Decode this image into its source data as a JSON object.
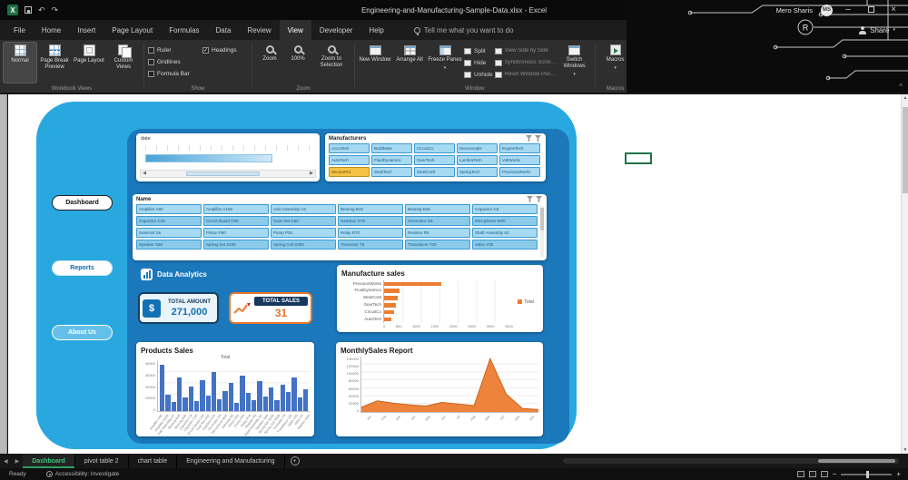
{
  "title_bar": {
    "title": "Engineering-and-Manufacturing-Sample-Data.xlsx - Excel",
    "user_name": "Mero Sharis",
    "user_initials": "MS"
  },
  "ribbon": {
    "tabs": [
      "File",
      "Home",
      "Insert",
      "Page Layout",
      "Formulas",
      "Data",
      "Review",
      "View",
      "Developer",
      "Help"
    ],
    "active_tab": "View",
    "tell_me": "Tell me what you want to do",
    "share_label": "Share",
    "groups": {
      "workbook_views": {
        "label": "Workbook Views",
        "buttons": [
          "Normal",
          "Page Break Preview",
          "Page Layout",
          "Custom Views"
        ],
        "active_button": "Normal"
      },
      "show": {
        "label": "Show",
        "checkboxes": [
          {
            "label": "Ruler",
            "checked": false
          },
          {
            "label": "Gridlines",
            "checked": false
          },
          {
            "label": "Formula Bar",
            "checked": false
          },
          {
            "label": "Headings",
            "checked": true
          }
        ]
      },
      "zoom": {
        "label": "Zoom",
        "buttons": [
          "Zoom",
          "100%",
          "Zoom to Selection"
        ]
      },
      "window": {
        "label": "Window",
        "big_buttons": [
          "New Window",
          "Arrange All",
          "Freeze Panes"
        ],
        "small_buttons": [
          "Split",
          "Hide",
          "Unhide"
        ],
        "toggle_buttons": [
          "View Side by Side",
          "Synchronous Scrolling",
          "Reset Window Position"
        ],
        "switch_button": "Switch Windows"
      },
      "macros": {
        "label": "Macros",
        "buttons": [
          "Macros"
        ]
      }
    }
  },
  "dashboard": {
    "sidebar": [
      "Dashboard",
      "Reports",
      "About Us"
    ],
    "timeline": {
      "label": "date"
    },
    "manufacturers_slicer": {
      "title": "Manufacturers",
      "selected": "SecurePro",
      "items": [
        "AccuTech",
        "BuildMate",
        "CircuitCo",
        "Dieconcepts",
        "EngineTech",
        "AutoTech",
        "FluidDynamics",
        "GearTech",
        "LumbraTech",
        "VoltWorks",
        "SecurePro",
        "SteelTech",
        "SteelCraft",
        "SpringTech",
        "PrecisionWorks"
      ]
    },
    "name_slicer": {
      "title": "Name",
      "items": [
        "Amplifier A90",
        "Amplifier A100",
        "Axle Assembly A3",
        "Bearing B18",
        "Bearing B45",
        "Capacitor C8",
        "Capacitor C40",
        "Circuit Board C90",
        "Gear Set G50",
        "Gearbox G70",
        "Generator G9",
        "Microphone M30",
        "Solenoid S6",
        "Piston P60",
        "Pump P30",
        "Relay R70",
        "Resistor R5",
        "Shaft Assembly S2",
        "Speaker S50",
        "Spring Set S200",
        "Spring Coil S300",
        "Transistor T5",
        "Transducer T20",
        "Valve V30"
      ]
    },
    "analytics_title": "Data Analytics",
    "kpis": [
      {
        "label": "TOTAL AMOUNT",
        "value": "271,000",
        "symbol": "$",
        "icon": "dollar-icon"
      },
      {
        "label": "TOTAL SALES",
        "value": "31",
        "icon": "line-chart-icon"
      }
    ]
  },
  "chart_data": [
    {
      "id": "manufacture-sales",
      "type": "bar",
      "orientation": "horizontal",
      "title": "Manufacture sales",
      "categories": [
        "PrecisionWorks",
        "FluidDynamics",
        "SteelCraft",
        "GearTech",
        "CircuitCo",
        "AutoTech"
      ],
      "values": [
        1550,
        420,
        380,
        320,
        260,
        200
      ],
      "xlim": [
        0,
        3500
      ],
      "xticks": [
        0,
        500,
        1000,
        1500,
        2000,
        2500,
        3000,
        3500
      ],
      "legend": [
        "Total"
      ],
      "color": "#ED7D31",
      "grid": true
    },
    {
      "id": "products-sales",
      "type": "bar",
      "title": "Products Sales",
      "subtitle": "Total",
      "categories": [
        "Amplifier A90",
        "Amplifier A100",
        "Axle Assembly A3",
        "Bearing B18",
        "Bearing B45",
        "Capacitor C8",
        "Capacitor C40",
        "Circuit Board C90",
        "Gear Set G50",
        "Gearbox G70",
        "Generator G9",
        "Microphone M30",
        "Solenoid S6",
        "Piston P60",
        "Pump P30",
        "Relay R70",
        "Resistor R5",
        "Shaft Assembly S2",
        "Speaker S50",
        "Spring Set S200",
        "Spring Coil S300",
        "Transistor T5",
        "Transducer T20",
        "Valve V30",
        "Valve V9",
        "Washer W40"
      ],
      "values": [
        42000,
        15000,
        8000,
        30000,
        12000,
        22000,
        9000,
        28000,
        14000,
        35000,
        11000,
        18000,
        25000,
        7000,
        32000,
        16000,
        10000,
        27000,
        13000,
        21000,
        9500,
        24000,
        17000,
        30000,
        12500,
        20000
      ],
      "ylim": [
        0,
        45000
      ],
      "yticks": [
        0,
        10000,
        20000,
        30000,
        40000
      ],
      "color": "#4472C4",
      "grid": true
    },
    {
      "id": "monthly-sales",
      "type": "area",
      "title": "MonthlySales Report",
      "categories": [
        "Jan",
        "Feb",
        "Mar",
        "Apr",
        "May",
        "Jun",
        "Jul",
        "Aug",
        "Sep",
        "Oct",
        "Nov",
        "Dec"
      ],
      "values": [
        12000,
        28000,
        22000,
        18000,
        15000,
        24000,
        20000,
        16000,
        135000,
        45000,
        9000,
        6000
      ],
      "ylim": [
        0,
        140000
      ],
      "yticks": [
        0,
        20000,
        40000,
        60000,
        80000,
        100000,
        120000,
        140000
      ],
      "color": "#ED7D31",
      "grid": true
    }
  ],
  "sheet_tabs": {
    "tabs": [
      {
        "label": "Dashboard",
        "active": true
      },
      {
        "label": "pivot table 2",
        "active": false
      },
      {
        "label": "chart table",
        "active": false
      },
      {
        "label": "Engineering and Manufacturing",
        "active": false
      }
    ],
    "add_label": "+"
  },
  "status_bar": {
    "mode": "Ready",
    "accessibility": "Accessibility: Investigate"
  }
}
